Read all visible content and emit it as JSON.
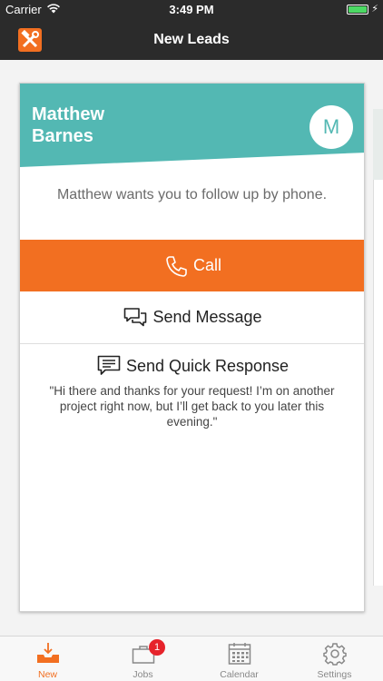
{
  "status_bar": {
    "carrier": "Carrier",
    "time": "3:49 PM",
    "wifi_icon": "wifi-icon",
    "battery_icon": "battery-icon"
  },
  "nav": {
    "title": "New Leads",
    "logo_icon": "hammer-wrench-logo"
  },
  "lead": {
    "name": "Matthew Barnes",
    "avatar_initial": "M",
    "message": "Matthew wants you to follow up by phone.",
    "call_label": "Call",
    "send_message_label": "Send Message",
    "quick_response_label": "Send Quick Response",
    "quick_response_text": "\"Hi there and thanks for your request! I’m on another project right now, but I’ll get back to you later this evening.\""
  },
  "tabs": [
    {
      "label": "New",
      "icon": "inbox-download-icon",
      "active": true
    },
    {
      "label": "Jobs",
      "icon": "briefcase-icon",
      "badge": "1"
    },
    {
      "label": "Calendar",
      "icon": "calendar-icon"
    },
    {
      "label": "Settings",
      "icon": "gear-icon"
    }
  ],
  "colors": {
    "accent": "#f26f21",
    "header_teal": "#53b8b3",
    "nav_bg": "#2b2b2b",
    "badge_red": "#e6232b"
  }
}
